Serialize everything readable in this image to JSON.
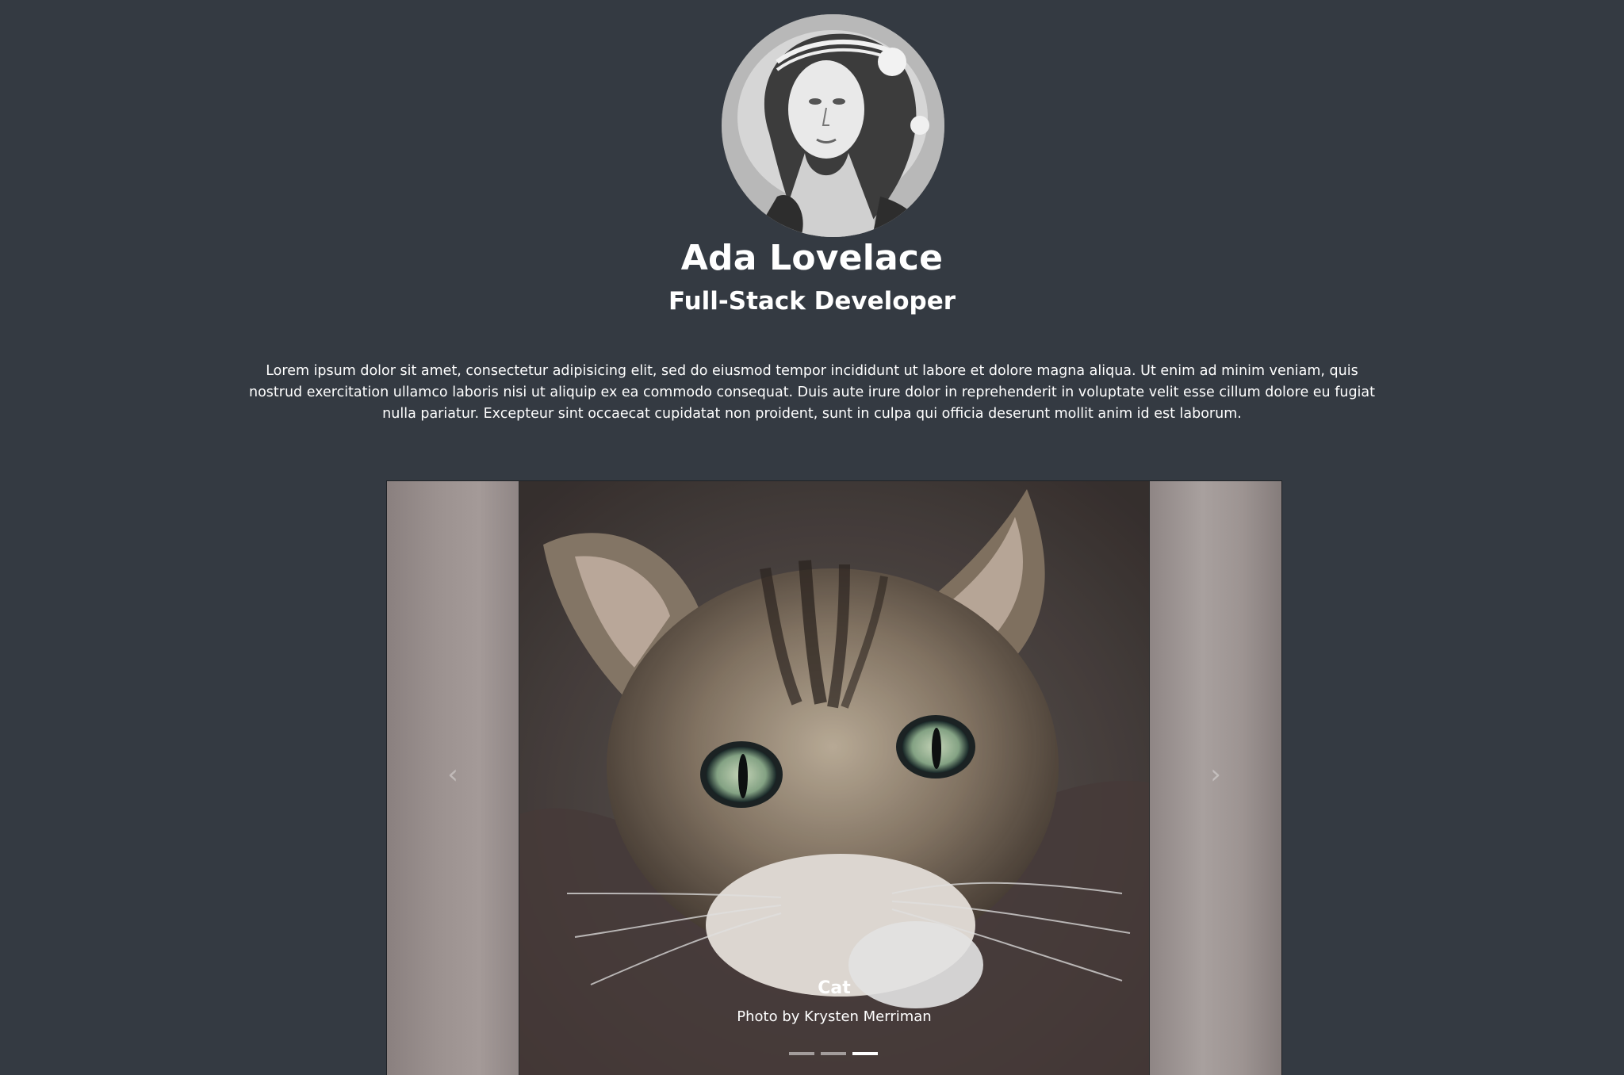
{
  "profile": {
    "name": "Ada Lovelace",
    "role": "Full-Stack Developer",
    "bio": "Lorem ipsum dolor sit amet, consectetur adipisicing elit, sed do eiusmod tempor incididunt ut labore et dolore magna aliqua. Ut enim ad minim veniam, quis nostrud exercitation ullamco laboris nisi ut aliquip ex ea commodo consequat. Duis aute irure dolor in reprehenderit in voluptate velit esse cillum dolore eu fugiat nulla pariatur. Excepteur sint occaecat cupidatat non proident, sunt in culpa qui officia deserunt mollit anim id est laborum."
  },
  "carousel": {
    "prev_icon": "chevron-left-icon",
    "next_icon": "chevron-right-icon",
    "prev_glyph": "‹",
    "next_glyph": "›",
    "active_slide": {
      "title": "Cat",
      "credit": "Photo by Krysten Merriman"
    },
    "slide_count": 3,
    "active_index": 3
  },
  "colors": {
    "background": "#343a42",
    "text": "#ffffff"
  }
}
